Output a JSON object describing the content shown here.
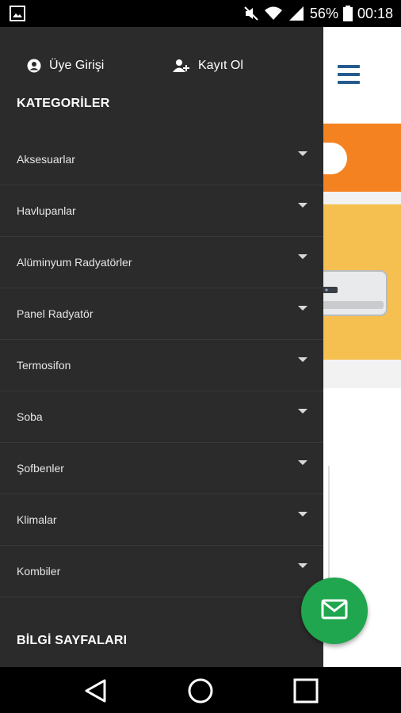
{
  "status_bar": {
    "battery": "56%",
    "time": "00:18",
    "icons": [
      "image-icon",
      "mute-icon",
      "wifi-icon",
      "signal-icon",
      "battery-icon"
    ]
  },
  "drawer": {
    "auth": {
      "login_label": "Üye Girişi",
      "register_label": "Kayıt Ol"
    },
    "categories_title": "KATEGORİLER",
    "categories": [
      "Aksesuarlar",
      "Havlupanlar",
      "Alüminyum Radyatörler",
      "Panel Radyatör",
      "Termosifon",
      "Soba",
      "Şofbenler",
      "Klimalar",
      "Kombiler"
    ],
    "info_title": "BİLGİ SAYFALARI"
  },
  "colors": {
    "drawer_bg": "#2b2b2b",
    "accent_orange": "#f58220",
    "banner_yellow": "#f5c04f",
    "fab_green": "#20a64e",
    "menu_blue": "#245b8f"
  }
}
